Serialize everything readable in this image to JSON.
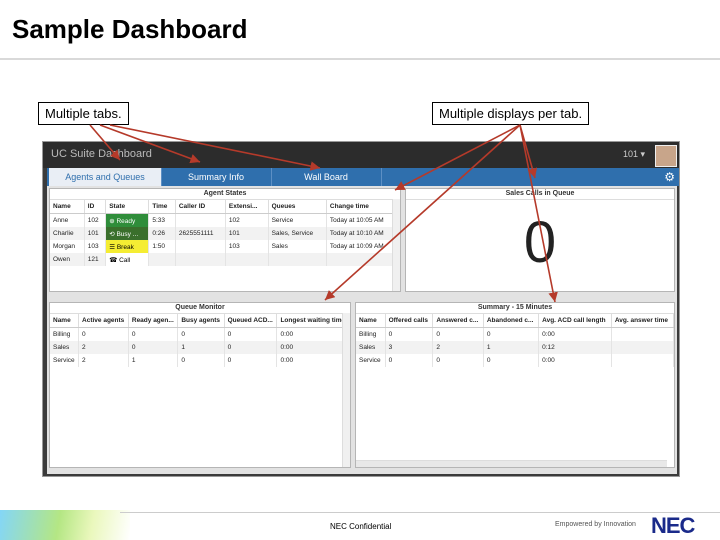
{
  "slide": {
    "title": "Sample Dashboard",
    "callout_left": "Multiple tabs.",
    "callout_right": "Multiple displays per tab.",
    "footer_confidential": "NEC Confidential",
    "footer_tagline": "Empowered by Innovation",
    "footer_logo": "NEC"
  },
  "app": {
    "title": "UC Suite Dashboard",
    "user": "101 ▾",
    "tabs": [
      {
        "label": "Agents and Queues",
        "active": true
      },
      {
        "label": "Summary Info",
        "active": false
      },
      {
        "label": "Wall Board",
        "active": false
      }
    ]
  },
  "agent_states": {
    "title": "Agent States",
    "columns": [
      "Name",
      "ID",
      "State",
      "Time",
      "Caller ID",
      "Extensi...",
      "Queues",
      "Change time"
    ],
    "rows": [
      [
        "Anne",
        "102",
        "⊕ Ready",
        "5:33",
        "",
        "102",
        "Service",
        "Today at 10:05 AM"
      ],
      [
        "Charlie",
        "101",
        "⟲ Busy ...",
        "0:26",
        "2625551111",
        "101",
        "Sales, Service",
        "Today at 10:10 AM"
      ],
      [
        "Morgan",
        "103",
        "☰ Break",
        "1:50",
        "",
        "103",
        "Sales",
        "Today at 10:09 AM"
      ],
      [
        "Owen",
        "121",
        "☎ Call",
        "",
        "",
        "",
        "",
        ""
      ]
    ],
    "state_colors": [
      "#2f8d3a",
      "#3a6f2c",
      "#f5ed33",
      "#ffffff"
    ]
  },
  "sales_calls": {
    "title": "Sales Calls in Queue",
    "value": "0"
  },
  "queue_monitor": {
    "title": "Queue Monitor",
    "columns": [
      "Name",
      "Active agents",
      "Ready agen...",
      "Busy agents",
      "Queued ACD...",
      "Longest waiting time"
    ],
    "rows": [
      [
        "Billing",
        "0",
        "0",
        "0",
        "0",
        "0:00"
      ],
      [
        "Sales",
        "2",
        "0",
        "1",
        "0",
        "0:00"
      ],
      [
        "Service",
        "2",
        "1",
        "0",
        "0",
        "0:00"
      ]
    ]
  },
  "summary": {
    "title": "Summary - 15 Minutes",
    "columns": [
      "Name",
      "Offered calls",
      "Answered c...",
      "Abandoned c...",
      "Avg. ACD call length",
      "Avg. answer time"
    ],
    "rows": [
      [
        "Billing",
        "0",
        "0",
        "0",
        "0:00",
        ""
      ],
      [
        "Sales",
        "3",
        "2",
        "1",
        "0:12",
        ""
      ],
      [
        "Service",
        "0",
        "0",
        "0",
        "0:00",
        ""
      ]
    ]
  },
  "colors": {
    "tab_bar": "#2f6fad",
    "arrow": "#b53a2a",
    "nec_blue": "#1a2a8a"
  }
}
